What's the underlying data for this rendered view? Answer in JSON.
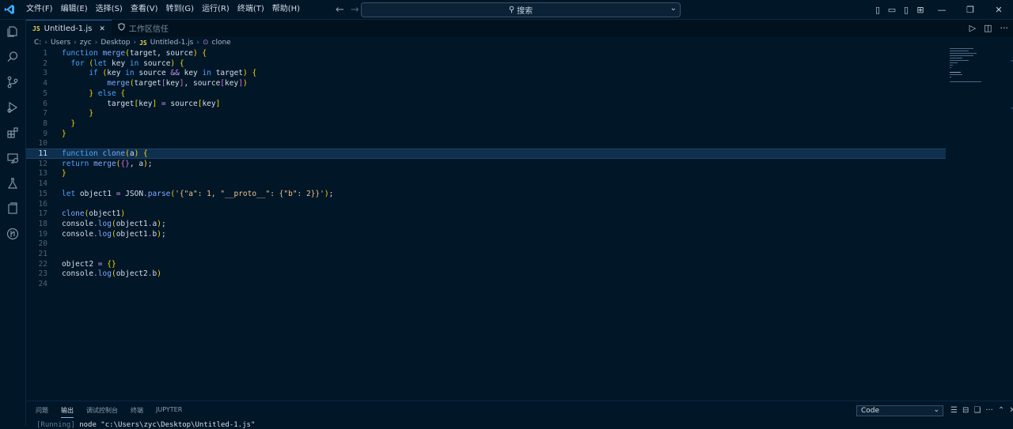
{
  "menu": [
    "文件(F)",
    "编辑(E)",
    "选择(S)",
    "查看(V)",
    "转到(G)",
    "运行(R)",
    "终端(T)",
    "帮助(H)"
  ],
  "search": {
    "placeholder": "搜索"
  },
  "tabs": [
    {
      "label": "Untitled-1.js",
      "badge": "JS",
      "close": "✕",
      "active": true
    },
    {
      "label": "工作区信任",
      "active": false
    }
  ],
  "breadcrumb": [
    "C:",
    "Users",
    "zyc",
    "Desktop",
    "Untitled-1.js",
    "clone"
  ],
  "breadcrumb_file_badge": "JS",
  "code_lines": [
    "function merge(target, source) {",
    "  for (let key in source) {",
    "      if (key in source && key in target) {",
    "          merge(target[key], source[key])",
    "      } else {",
    "          target[key] = source[key]",
    "      }",
    "  }",
    "}",
    "",
    "function clone(a) {",
    "return merge({}, a);",
    "}",
    "",
    "let object1 = JSON.parse('{\"a\": 1, \"__proto__\": {\"b\": 2}}');",
    "",
    "clone(object1)",
    "console.log(object1.a);",
    "console.log(object1.b);",
    "",
    "",
    "object2 = {}",
    "console.log(object2.b)",
    ""
  ],
  "current_line": 11,
  "panel": {
    "tabs": [
      "问题",
      "输出",
      "调试控制台",
      "终端",
      "JUPYTER"
    ],
    "active_tab": "输出",
    "select_value": "Code",
    "output_prefix": "[Running]",
    "output_text": " node \"c:\\Users\\zyc\\Desktop\\Untitled-1.js\""
  },
  "colors": {
    "background": "#011627",
    "accent": "#4fa4ff",
    "highlight": "#0e2f4d"
  }
}
